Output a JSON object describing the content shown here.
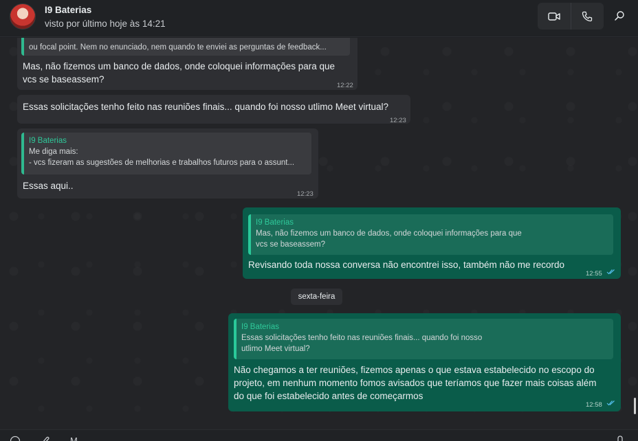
{
  "header": {
    "contact_name": "I9 Baterias",
    "status": "visto por último hoje às 14:21",
    "icons": [
      "video-call-icon",
      "voice-call-icon",
      "search-icon"
    ]
  },
  "messages": [
    {
      "direction": "in",
      "quote_text": "ou focal point. Nem no enunciado, nem quando te enviei as perguntas de feedback...",
      "text": "Mas, não fizemos um banco de dados, onde coloquei informações para que\nvcs se baseassem?",
      "time": "12:22"
    },
    {
      "direction": "in",
      "text": "Essas solicitações tenho feito nas reuniões finais... quando foi nosso utlimo Meet virtual?",
      "time": "12:23"
    },
    {
      "direction": "in",
      "quote_author": "I9 Baterias",
      "quote_text": "Me diga mais:\n- vcs fizeram as sugestões de melhorias e trabalhos futuros para o assunt...",
      "text": "Essas aqui..",
      "time": "12:23"
    },
    {
      "direction": "out",
      "quote_author": "I9 Baterias",
      "quote_text": "Mas, não fizemos um banco de dados, onde coloquei informações para que\nvcs se baseassem?",
      "text": "Revisando toda nossa conversa não encontrei isso, também não me recordo",
      "time": "12:55"
    },
    {
      "direction": "out",
      "quote_author": "I9 Baterias",
      "quote_text": "Essas solicitações tenho feito nas reuniões finais... quando foi nosso\nutlimo Meet virtual?",
      "text": "Não chegamos a ter reuniões, fizemos apenas o que estava estabelecido no escopo do\nprojeto, em nenhum momento fomos avisados que teríamos que fazer mais coisas além\ndo que foi estabelecido antes de começarmos",
      "time": "12:58"
    }
  ],
  "date_separator": "sexta-feira",
  "footer": {
    "icons": [
      "emoji-icon",
      "attach-icon",
      "microphone-icon"
    ],
    "placeholder_fragment": "M"
  },
  "colors": {
    "incoming_bubble": "#2e2f33",
    "outgoing_bubble": "#0a5c4a",
    "quote_accent": "#2fc99a",
    "read_ticks": "#53bdeb"
  }
}
